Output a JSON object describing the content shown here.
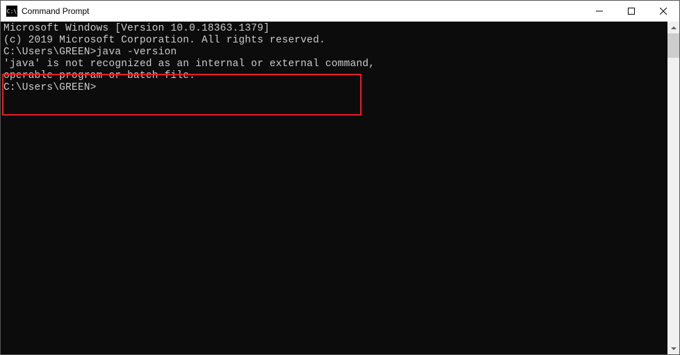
{
  "titlebar": {
    "icon_label": "C:\\",
    "title": "Command Prompt"
  },
  "terminal": {
    "header_line_1": "Microsoft Windows [Version 10.0.18363.1379]",
    "header_line_2": "(c) 2019 Microsoft Corporation. All rights reserved.",
    "blank_line": "",
    "prompt_1": "C:\\Users\\GREEN>",
    "command_1": "java -version",
    "error_line_1": "'java' is not recognized as an internal or external command,",
    "error_line_2": "operable program or batch file.",
    "prompt_2": "C:\\Users\\GREEN>"
  }
}
